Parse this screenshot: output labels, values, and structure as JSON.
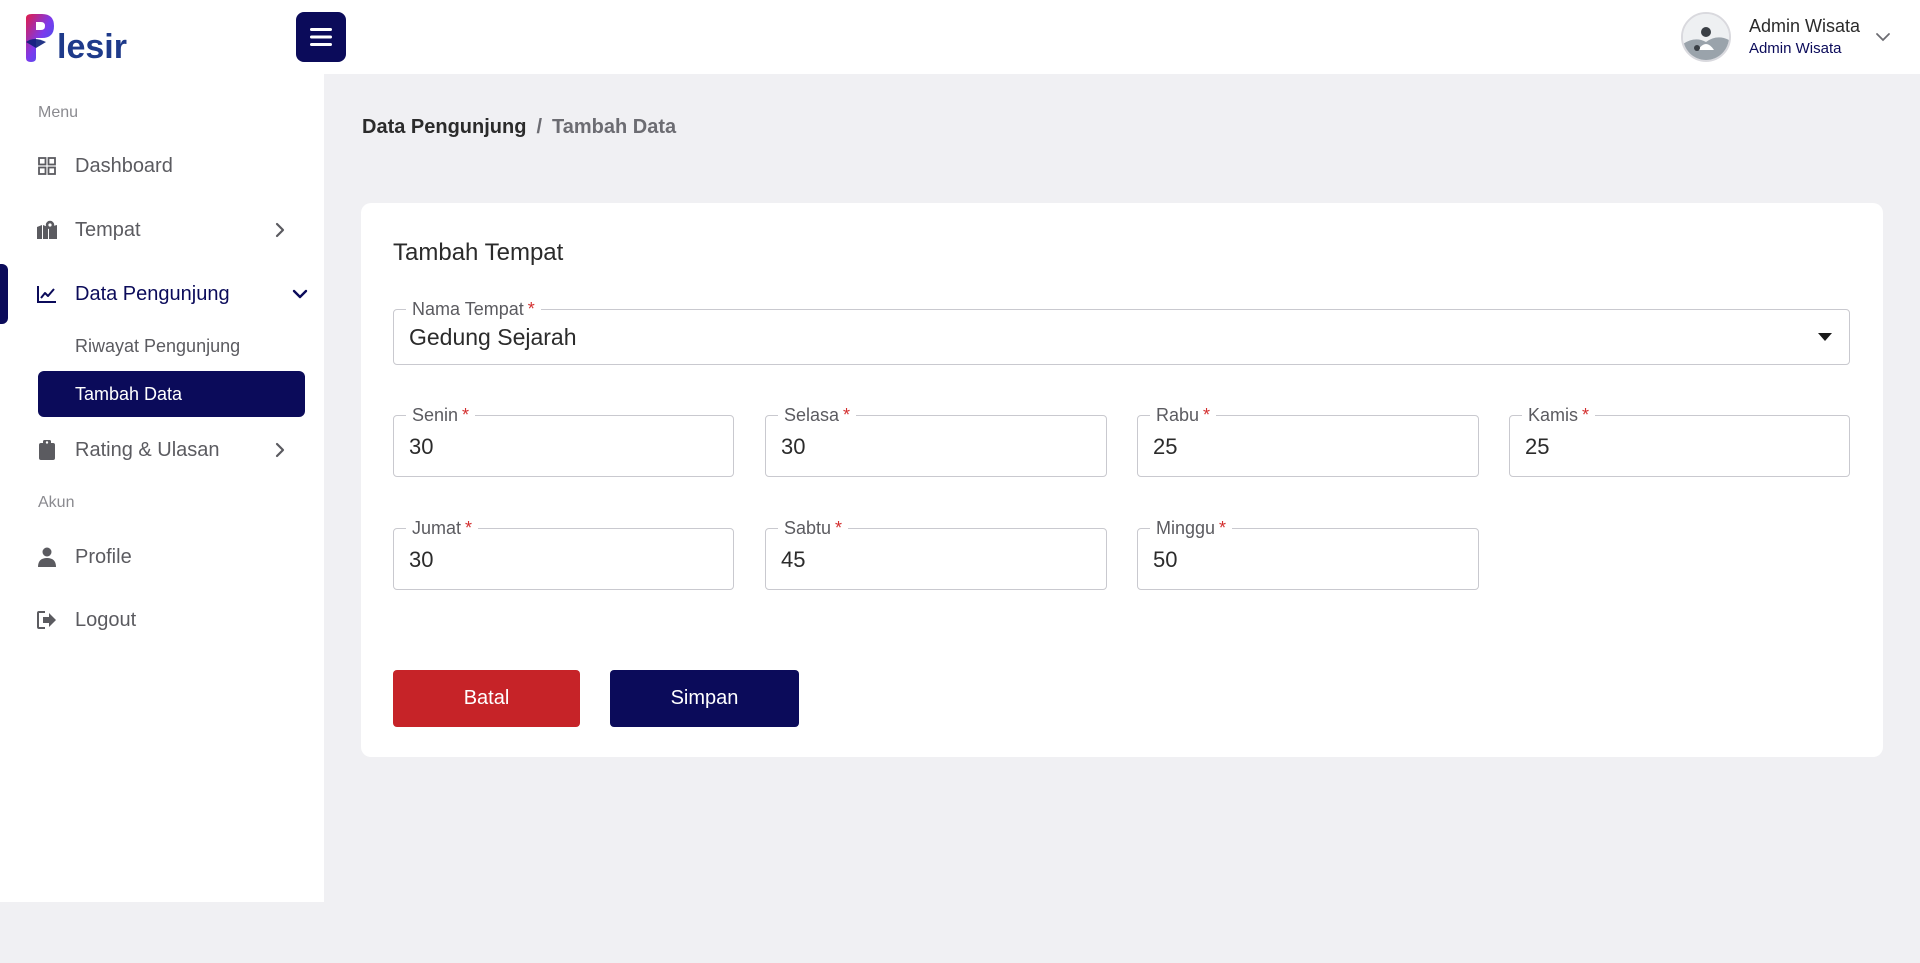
{
  "header": {
    "logo_text": "Plesir",
    "user_name": "Admin Wisata",
    "user_role": "Admin Wisata"
  },
  "sidebar": {
    "section_menu": "Menu",
    "section_account": "Akun",
    "items": {
      "dashboard": "Dashboard",
      "tempat": "Tempat",
      "data_pengunjung": "Data Pengunjung",
      "riwayat": "Riwayat Pengunjung",
      "tambah": "Tambah Data",
      "rating": "Rating & Ulasan",
      "profile": "Profile",
      "logout": "Logout"
    }
  },
  "breadcrumb": {
    "parent": "Data Pengunjung",
    "separator": "/",
    "current": "Tambah Data"
  },
  "form": {
    "title": "Tambah Tempat",
    "place": {
      "label": "Nama Tempat",
      "value": "Gedung Sejarah"
    },
    "required_mark": "*",
    "days": {
      "senin": {
        "label": "Senin",
        "value": "30"
      },
      "selasa": {
        "label": "Selasa",
        "value": "30"
      },
      "rabu": {
        "label": "Rabu",
        "value": "25"
      },
      "kamis": {
        "label": "Kamis",
        "value": "25"
      },
      "jumat": {
        "label": "Jumat",
        "value": "30"
      },
      "sabtu": {
        "label": "Sabtu",
        "value": "45"
      },
      "minggu": {
        "label": "Minggu",
        "value": "50"
      }
    },
    "cancel_label": "Batal",
    "save_label": "Simpan"
  },
  "colors": {
    "primary": "#0b0b5a",
    "danger": "#c62328",
    "required": "#d32f2f",
    "background": "#f0f0f3"
  },
  "icons": {
    "dashboard": "grid-icon",
    "tempat": "map-icon",
    "data_pengunjung": "line-chart-icon",
    "rating": "clipboard-icon",
    "profile": "user-icon",
    "logout": "logout-icon"
  }
}
